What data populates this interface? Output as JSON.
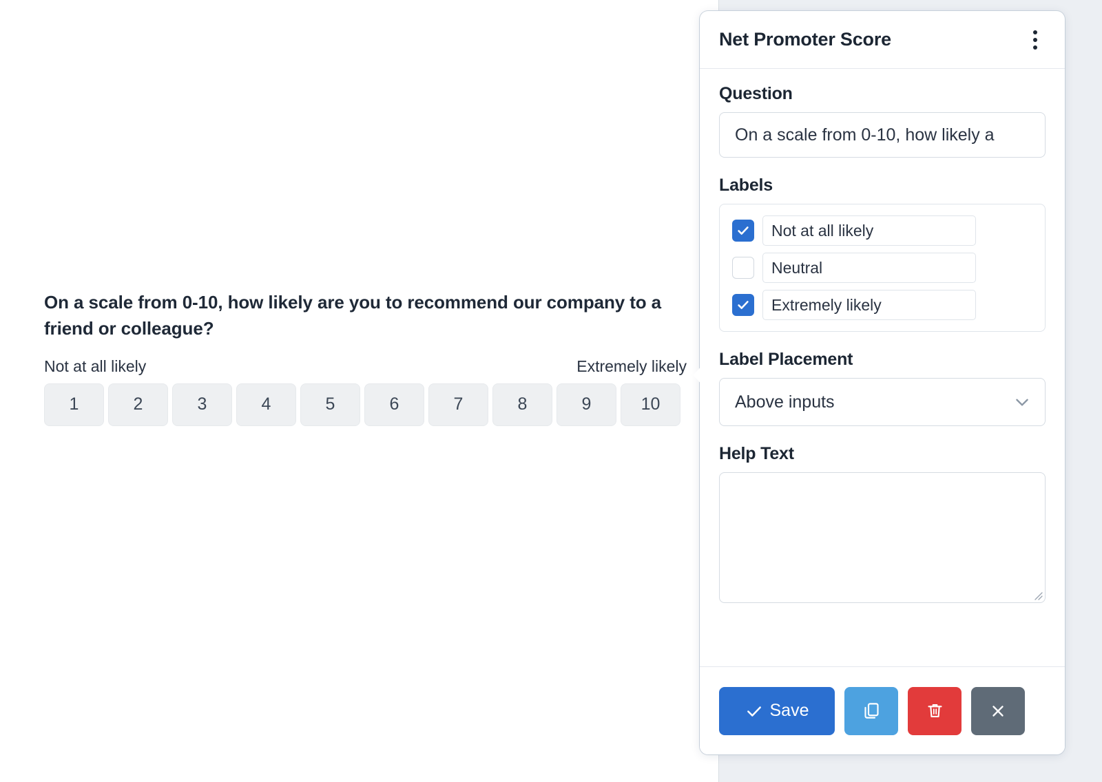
{
  "panel": {
    "title": "Net Promoter Score",
    "menu_icon": "kebab-menu-icon",
    "question": {
      "label": "Question",
      "value": "On a scale from 0-10, how likely a"
    },
    "labels": {
      "label": "Labels",
      "items": [
        {
          "text": "Not at all likely",
          "checked": true
        },
        {
          "text": "Neutral",
          "checked": false
        },
        {
          "text": "Extremely likely",
          "checked": true
        }
      ]
    },
    "label_placement": {
      "label": "Label Placement",
      "value": "Above inputs",
      "options": [
        "Above inputs"
      ]
    },
    "help_text": {
      "label": "Help Text",
      "value": ""
    },
    "footer": {
      "save_label": "Save",
      "copy_label": "",
      "delete_label": "",
      "close_label": ""
    }
  },
  "preview": {
    "question": "On a scale from 0-10, how likely are you to recommend our company to a friend or colleague?",
    "anchor_left": "Not at all likely",
    "anchor_right": "Extremely likely",
    "scale": [
      "1",
      "2",
      "3",
      "4",
      "5",
      "6",
      "7",
      "8",
      "9",
      "10"
    ]
  },
  "colors": {
    "accent": "#2b6fd0",
    "copy": "#4da2e0",
    "danger": "#e23b3b",
    "neutral": "#5f6b77",
    "panel_bg": "#ffffff",
    "app_bg": "#eceff3"
  }
}
